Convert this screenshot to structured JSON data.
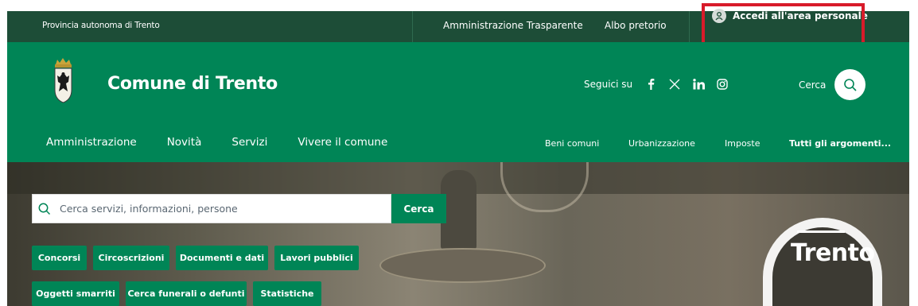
{
  "topbar": {
    "province": "Provincia autonoma di Trento",
    "links": [
      "Amministrazione Trasparente",
      "Albo pretorio"
    ],
    "login_label": "Accedi all'area personale"
  },
  "header": {
    "site_name": "Comune di Trento",
    "social_label": "Seguici su",
    "social_icons": [
      "facebook-icon",
      "x-icon",
      "linkedin-icon",
      "instagram-icon"
    ],
    "search_label": "Cerca"
  },
  "nav": {
    "main": [
      "Amministrazione",
      "Novità",
      "Servizi",
      "Vivere il comune"
    ],
    "topics": [
      "Beni comuni",
      "Urbanizzazione",
      "Imposte",
      "Tutti gli argomenti..."
    ]
  },
  "hero": {
    "search_placeholder": "Cerca servizi, informazioni, persone",
    "search_button": "Cerca",
    "logo_text": "Trento",
    "chips_row1": [
      "Concorsi",
      "Circoscrizioni",
      "Documenti e dati",
      "Lavori pubblici"
    ],
    "chips_row2": [
      "Oggetti smarriti",
      "Cerca funerali o defunti",
      "Statistiche"
    ]
  },
  "colors": {
    "topbar_bg": "#1d4d37",
    "header_bg": "#008556",
    "highlight": "#d81b2a"
  }
}
